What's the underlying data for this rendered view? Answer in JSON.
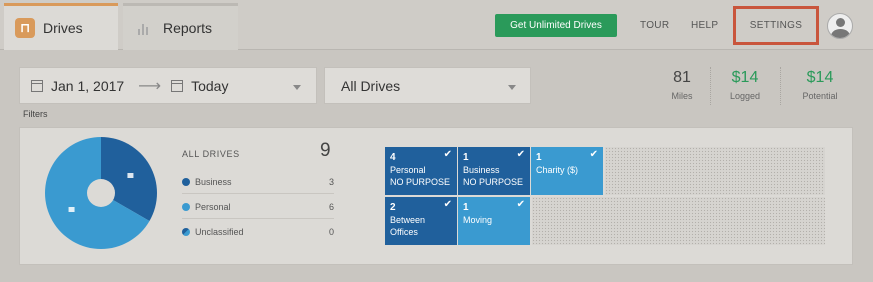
{
  "tabs": [
    {
      "label": "Drives",
      "icon": "drives-app-icon",
      "active": true
    },
    {
      "label": "Reports",
      "icon": "bar-chart-icon",
      "active": false
    }
  ],
  "header": {
    "upgrade_button": "Get Unlimited Drives",
    "tour": "TOUR",
    "help": "HELP",
    "settings": "SETTINGS",
    "profile_icon": "user-avatar-icon",
    "brand_color": "#2a9a5a",
    "highlight_color": "#c9553c"
  },
  "filters": {
    "start_date": "Jan 1, 2017",
    "end_date": "Today",
    "arrow": "⟶",
    "drive_type": "All Drives",
    "label": "Filters"
  },
  "stats": [
    {
      "value": "81",
      "label": "Miles"
    },
    {
      "value": "$14",
      "label": "Logged"
    },
    {
      "value": "$14",
      "label": "Potential"
    }
  ],
  "summary": {
    "title": "ALL DRIVES",
    "total": "9",
    "legend": [
      {
        "label": "Business",
        "count": "3",
        "color": "#20609c"
      },
      {
        "label": "Personal",
        "count": "6",
        "color": "#3a9ad0"
      },
      {
        "label": "Unclassified",
        "count": "0",
        "color": "#3a9ad0"
      }
    ]
  },
  "chart_data": {
    "type": "pie",
    "categories": [
      "Business",
      "Personal",
      "Unclassified"
    ],
    "values": [
      3,
      6,
      0
    ],
    "colors": [
      "#20609c",
      "#3a9ad0",
      "#3a9ad0"
    ]
  },
  "tiles": [
    {
      "count": "4",
      "line1": "Personal",
      "line2": "NO PURPOSE",
      "style": "dark"
    },
    {
      "count": "1",
      "line1": "Business",
      "line2": "NO PURPOSE",
      "style": "dark"
    },
    {
      "count": "1",
      "line1": "Charity ($)",
      "line2": "",
      "style": "light"
    },
    {
      "count": "2",
      "line1": "Between",
      "line2": "Offices",
      "style": "dark"
    },
    {
      "count": "1",
      "line1": "Moving",
      "line2": "",
      "style": "light"
    }
  ]
}
